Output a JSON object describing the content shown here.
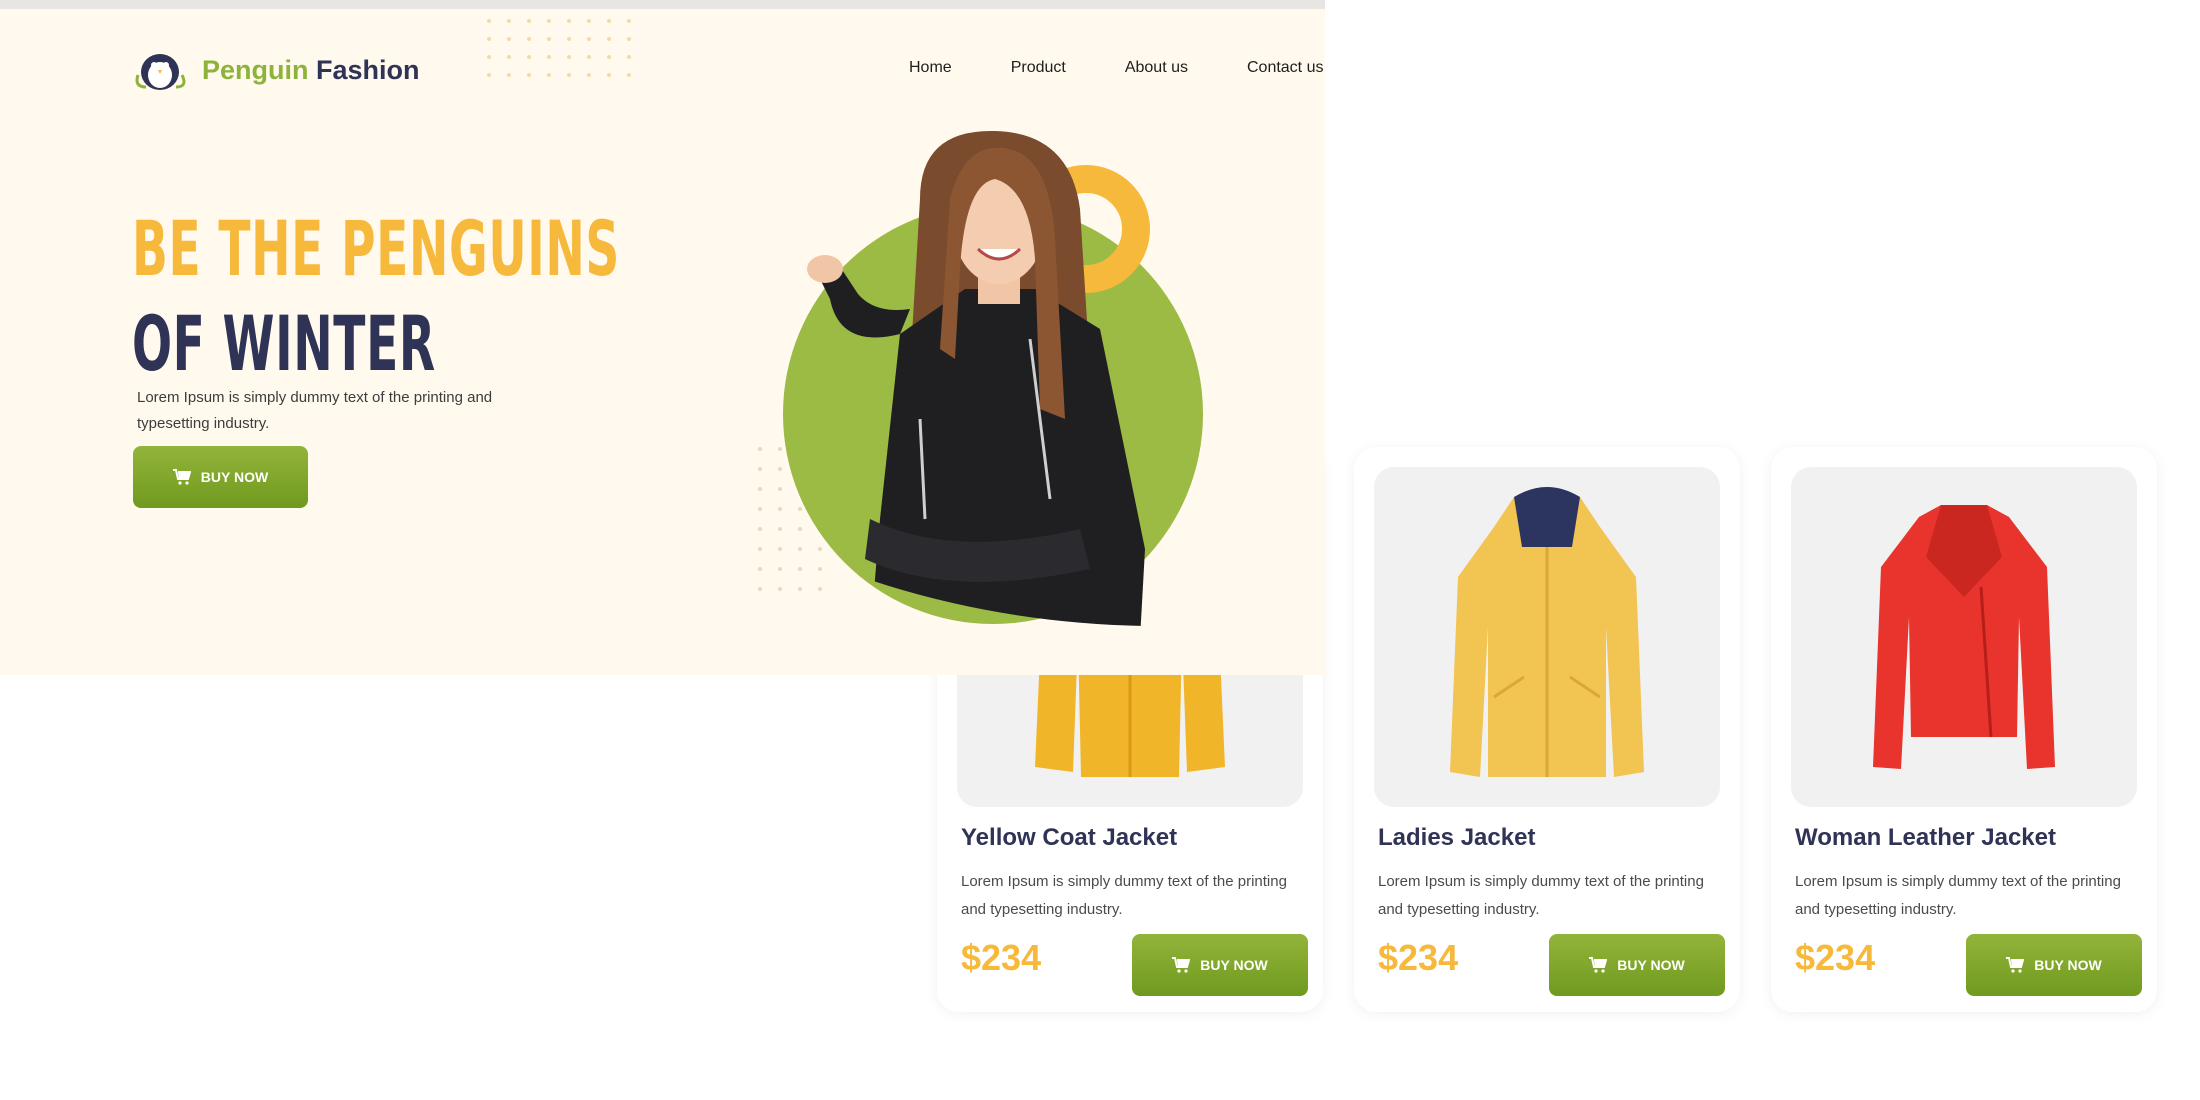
{
  "header": {
    "brand_part1": "Penguin",
    "brand_part2": "Fashion",
    "nav": [
      "Home",
      "Product",
      "About us",
      "Contact us"
    ]
  },
  "hero": {
    "headline_line1": "BE THE PENGUINS",
    "headline_line2": "OF WINTER",
    "description": "Lorem Ipsum is simply dummy text of the printing and typesetting industry.",
    "button_label": "BUY NOW",
    "button_icon": "cart-icon"
  },
  "products": [
    {
      "name": "Yellow Coat Jacket",
      "description": "Lorem Ipsum is simply dummy text of the printing and typesetting industry.",
      "price": "$234",
      "button_label": "BUY NOW"
    },
    {
      "name": "Ladies Jacket",
      "description": "Lorem Ipsum is simply dummy text of the printing and typesetting industry.",
      "price": "$234",
      "button_label": "BUY NOW"
    },
    {
      "name": "Woman Leather Jacket",
      "description": "Lorem Ipsum is simply dummy text of the printing and typesetting industry.",
      "price": "$234",
      "button_label": "BUY NOW"
    }
  ],
  "colors": {
    "accent_green": "#8db33a",
    "accent_yellow": "#f6b93b",
    "navy": "#2f3356",
    "hero_bg": "#fff9ee"
  }
}
